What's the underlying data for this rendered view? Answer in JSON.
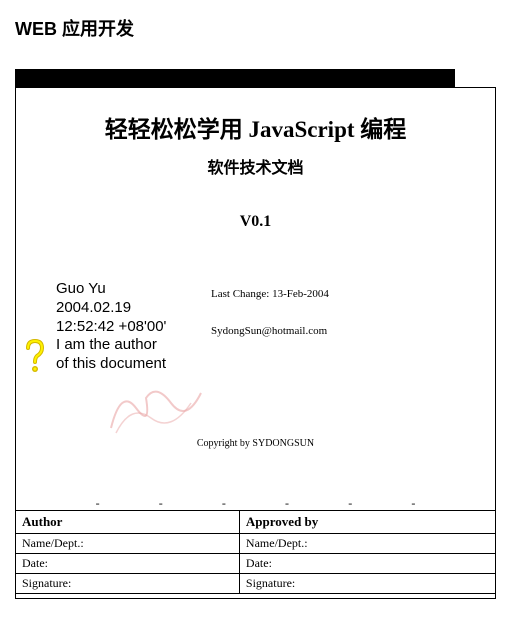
{
  "header": "WEB 应用开发",
  "title": "轻轻松松学用 JavaScript 编程",
  "subtitle": "软件技术文档",
  "version": "V0.1",
  "last_change_label": "Last Change: 13-Feb-2004",
  "email": "SydongSun@hotmail.com",
  "signature": {
    "name": "Guo Yu",
    "date": "2004.02.19",
    "time": "12:52:42 +08'00'",
    "line1": "I am the author",
    "line2": "of this document"
  },
  "copyright": "Copyright by SYDONGSUN",
  "dashes": [
    "-",
    "-",
    "-",
    "-",
    "-",
    "-"
  ],
  "table": {
    "author_header": "Author",
    "approved_header": "Approved by",
    "name_label": "Name/Dept.:",
    "date_label": "Date:",
    "sig_label": "Signature:"
  }
}
